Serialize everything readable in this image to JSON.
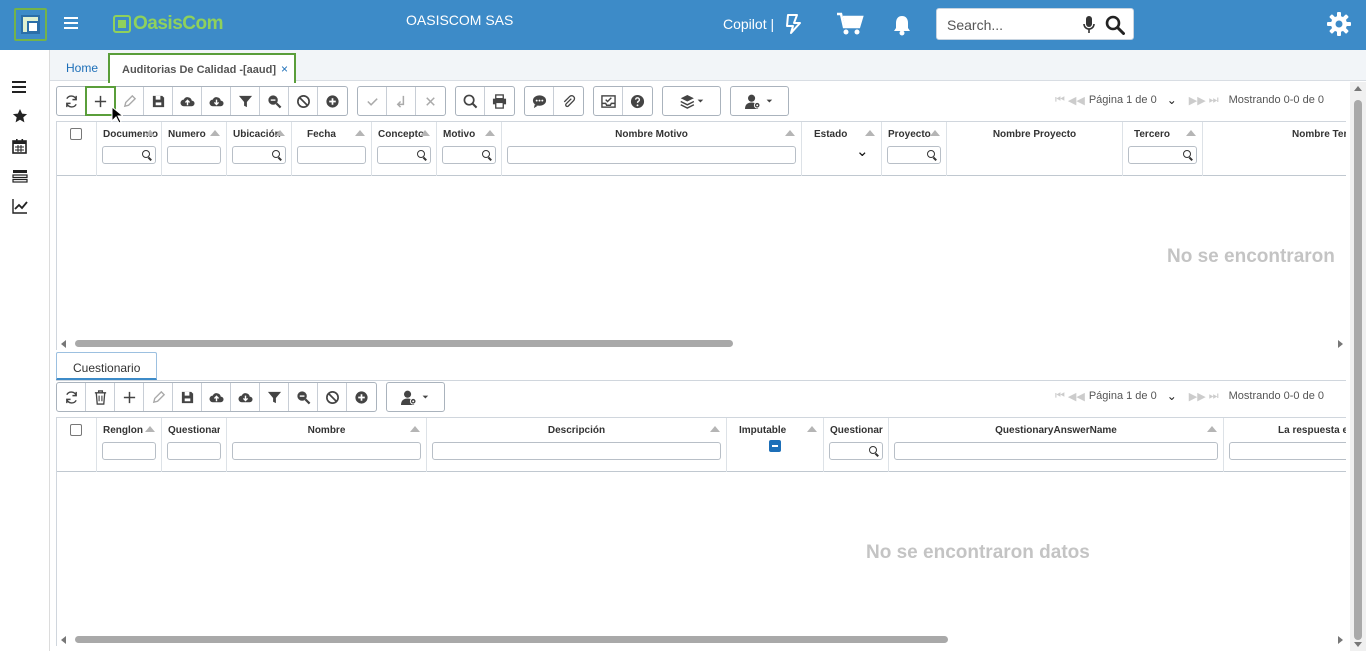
{
  "header": {
    "company": "OASISCOM SAS",
    "copilot_label": "Copilot |",
    "search_placeholder": "Search...",
    "logo_text": "OasisCom"
  },
  "tabs": {
    "home": "Home",
    "active": "Auditorias De Calidad -[aaud]",
    "close": "×"
  },
  "main_grid": {
    "pager": {
      "page": "Página 1 de 0",
      "showing": "Mostrando 0-0 de 0"
    },
    "columns": [
      {
        "label": "Documento",
        "filter": "search"
      },
      {
        "label": "Numero",
        "filter": "text"
      },
      {
        "label": "Ubicación",
        "filter": "search"
      },
      {
        "label": "Fecha",
        "filter": "text"
      },
      {
        "label": "Concepto",
        "filter": "search"
      },
      {
        "label": "Motivo",
        "filter": "search"
      },
      {
        "label": "Nombre Motivo",
        "filter": "text"
      },
      {
        "label": "Estado",
        "filter": "select"
      },
      {
        "label": "Proyecto",
        "filter": "search"
      },
      {
        "label": "Nombre Proyecto",
        "filter": "none"
      },
      {
        "label": "Tercero",
        "filter": "search"
      },
      {
        "label": "Nombre Tercero",
        "filter": "none"
      }
    ],
    "empty_text": "No se encontraron"
  },
  "sub_tab": "Cuestionario",
  "sub_grid": {
    "pager": {
      "page": "Página 1 de 0",
      "showing": "Mostrando 0-0 de 0"
    },
    "columns": [
      {
        "label": "Renglon",
        "filter": "text"
      },
      {
        "label": "QuestionaryId",
        "filter": "text"
      },
      {
        "label": "Nombre",
        "filter": "text"
      },
      {
        "label": "Descripción",
        "filter": "text"
      },
      {
        "label": "Imputable",
        "filter": "checkbox"
      },
      {
        "label": "QuestionaryAnswer",
        "filter": "search"
      },
      {
        "label": "QuestionaryAnswerName",
        "filter": "text"
      },
      {
        "label": "La respuesta es",
        "filter": "text"
      }
    ],
    "empty_text": "No se encontraron datos"
  },
  "colors": {
    "topbar": "#3d8bc8",
    "accent_green": "#5a9e3a",
    "link": "#1d6fb8"
  }
}
